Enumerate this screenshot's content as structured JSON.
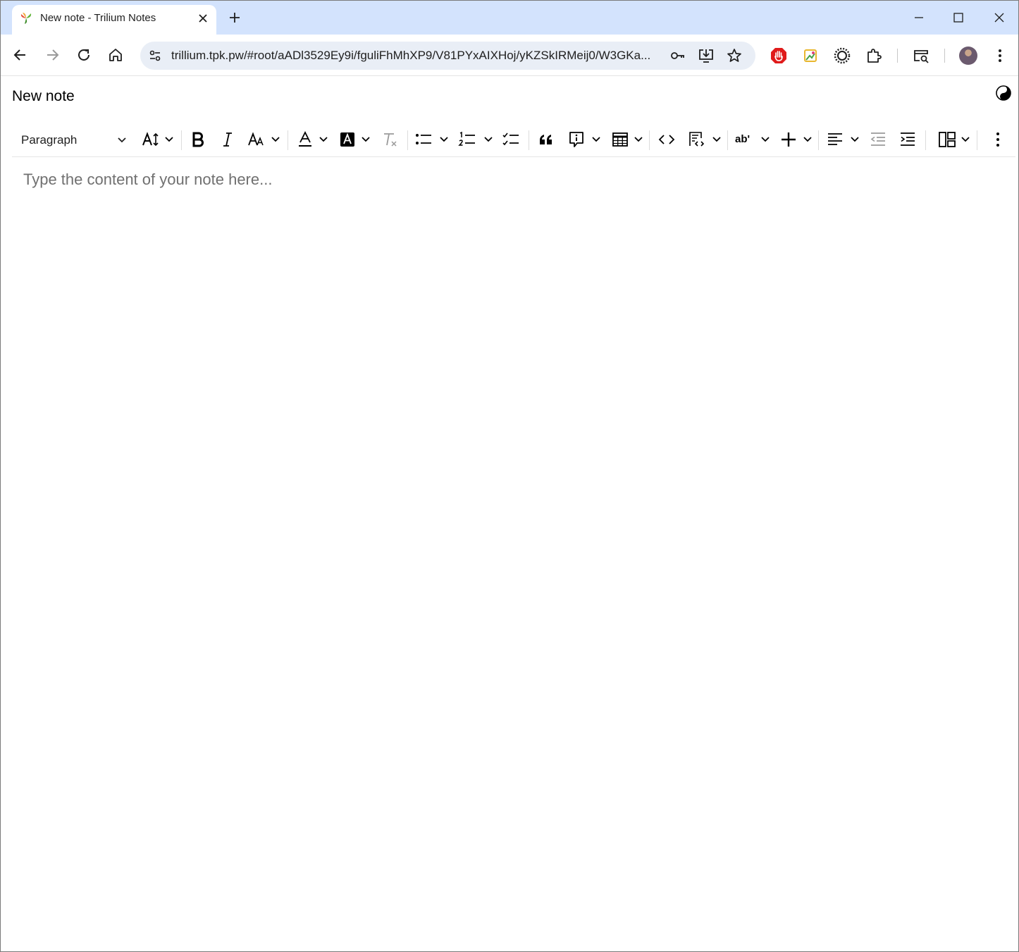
{
  "browser": {
    "tab_title": "New note - Trilium Notes",
    "url": "trillium.tpk.pw/#root/aADl3529Ey9i/fguliFhMhXP9/V81PYxAIXHoj/yKZSkIRMeij0/W3GKa..."
  },
  "note": {
    "title": "New note",
    "placeholder": "Type the content of your note here..."
  },
  "editor_toolbar": {
    "heading_select": "Paragraph",
    "highlight_label": "ab'"
  },
  "colors": {
    "tabstrip_bg": "#d3e3fd",
    "omnibox_bg": "#e9eef6",
    "placeholder_text": "#707070",
    "disabled_icon": "#9a9a9a"
  }
}
